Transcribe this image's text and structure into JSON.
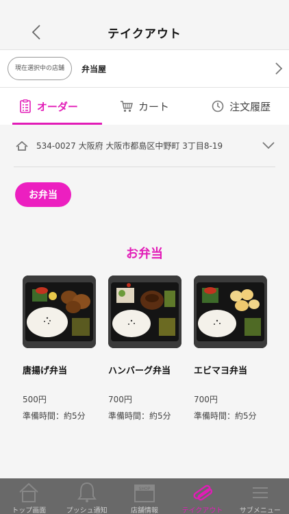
{
  "header": {
    "title": "テイクアウト"
  },
  "store": {
    "badge": "現在選択中の店舗",
    "name": "弁当屋"
  },
  "tabs": [
    {
      "label": "オーダー",
      "icon": "order-list-icon",
      "active": true
    },
    {
      "label": "カート",
      "icon": "cart-icon",
      "active": false
    },
    {
      "label": "注文履歴",
      "icon": "clock-icon",
      "active": false
    }
  ],
  "address": {
    "text": "534-0027 大阪府 大阪市都島区中野町 3丁目8-19"
  },
  "category": {
    "label": "お弁当"
  },
  "section": {
    "title": "お弁当"
  },
  "items": [
    {
      "name": "唐揚げ弁当",
      "price": "500円",
      "prep": "準備時間：約5分"
    },
    {
      "name": "ハンバーグ弁当",
      "price": "700円",
      "prep": "準備時間：約5分"
    },
    {
      "name": "エビマヨ弁当",
      "price": "700円",
      "prep": "準備時間：約5分"
    }
  ],
  "bottom_nav": [
    {
      "label": "トップ画面",
      "icon": "home-icon",
      "active": false
    },
    {
      "label": "プッシュ通知",
      "icon": "bell-icon",
      "active": false
    },
    {
      "label": "店舗情報",
      "icon": "shop-icon",
      "active": false,
      "icon_text": "SHOP"
    },
    {
      "label": "テイクアウト",
      "icon": "takeout-icon",
      "active": true
    },
    {
      "label": "サブメニュー",
      "icon": "menu-icon",
      "active": false
    }
  ],
  "colors": {
    "accent": "#e21bb7",
    "pill": "#ec1fc0",
    "bottom_bar": "#696969"
  }
}
